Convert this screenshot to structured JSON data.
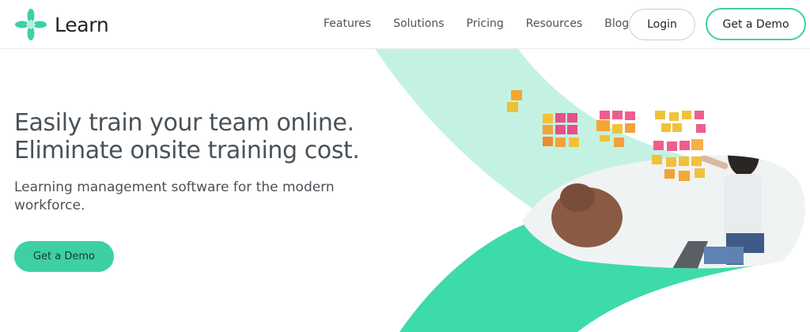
{
  "brand": {
    "name": "Learn",
    "logo_icon": "clover-cross-icon",
    "accent": "#3ecfa5"
  },
  "nav": {
    "links": [
      "Features",
      "Solutions",
      "Pricing",
      "Resources",
      "Blog"
    ],
    "login_label": "Login",
    "demo_label": "Get a Demo"
  },
  "hero": {
    "headline_line1": "Easily train your team online.",
    "headline_line2": "Eliminate onsite training cost.",
    "subheadline": "Learning management software for the modern workforce.",
    "cta_label": "Get a Demo",
    "image": "photo-woman-sticky-notes-whiteboard"
  },
  "colors": {
    "light_mint": "#c4f2e2",
    "mint": "#3ddbaa",
    "text": "#4a5258"
  }
}
